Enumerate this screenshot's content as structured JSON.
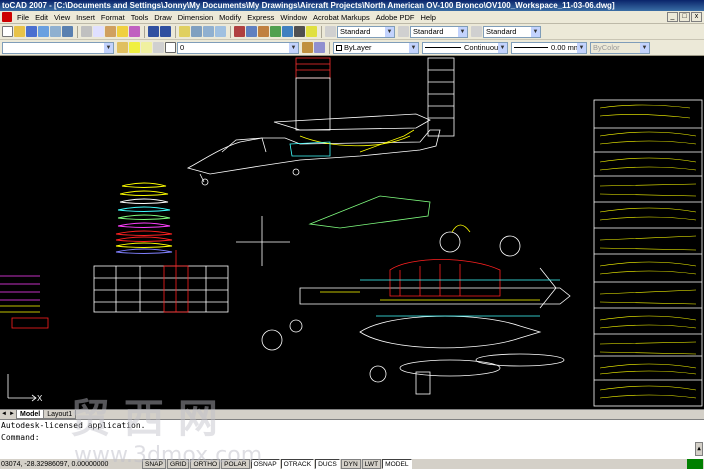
{
  "app": {
    "title": "toCAD 2007 - [C:\\Documents and Settings\\Jonny\\My Documents\\My Drawings\\Aircraft Projects\\North American OV-100 Bronco\\OV100_Workspace_11-03-06.dwg]"
  },
  "menu": {
    "items": [
      "File",
      "Edit",
      "View",
      "Insert",
      "Format",
      "Tools",
      "Draw",
      "Dimension",
      "Modify",
      "Express",
      "Window",
      "Acrobat Markups",
      "Adobe PDF",
      "Help"
    ],
    "win_buttons": [
      "_",
      "□",
      "x"
    ]
  },
  "toolbar": {
    "layer_value": "0",
    "text_style": "Standard",
    "dim_style": "Standard",
    "table_style": "Standard",
    "color_value": "ByLayer",
    "linetype_value": "Continuous",
    "lineweight_value": "0.00 mm",
    "plotstyle_value": "ByColor"
  },
  "tabs": {
    "arrows": [
      "◄",
      "►"
    ],
    "items": [
      "Model",
      "Layout1"
    ]
  },
  "command": {
    "lines": [
      "Autodesk-licensed application.",
      "Command:"
    ],
    "scroll_glyph": "▲"
  },
  "status": {
    "coords": "03074, -28.32986097, 0.00000000",
    "buttons": [
      {
        "label": "SNAP",
        "on": false
      },
      {
        "label": "GRID",
        "on": false
      },
      {
        "label": "ORTHO",
        "on": false
      },
      {
        "label": "POLAR",
        "on": false
      },
      {
        "label": "OSNAP",
        "on": true
      },
      {
        "label": "OTRACK",
        "on": true
      },
      {
        "label": "DUCS",
        "on": true
      },
      {
        "label": "DYN",
        "on": false
      },
      {
        "label": "LWT",
        "on": false
      },
      {
        "label": "MODEL",
        "on": true
      }
    ]
  },
  "ucs": {
    "x_label": "X"
  },
  "watermark": {
    "cjk": "贸 西 网",
    "url": "www.3dmox.com"
  },
  "colors": {
    "canvas": "#000000",
    "titlebar": "#0a246a",
    "wire_white": "#ffffff",
    "wire_yellow": "#ffff00",
    "wire_red": "#ff2020",
    "wire_green": "#80ff80",
    "wire_cyan": "#40ffff",
    "wire_magenta": "#ff40ff"
  }
}
